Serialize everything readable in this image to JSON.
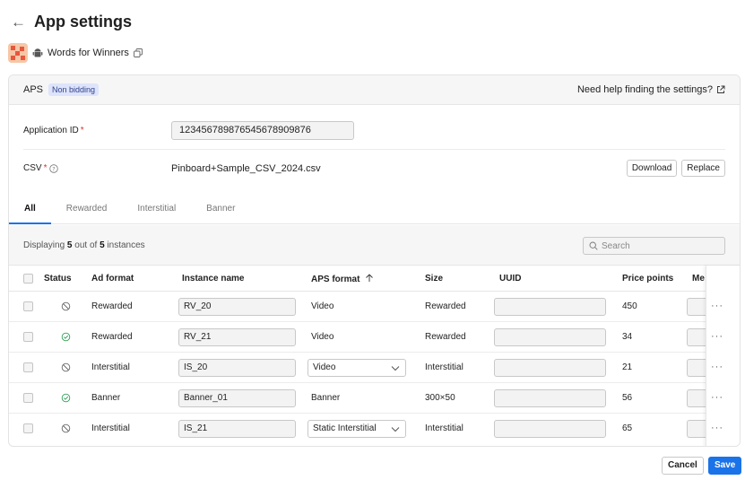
{
  "page": {
    "title": "App settings",
    "app_name": "Words for Winners"
  },
  "aps": {
    "label": "APS",
    "badge": "Non bidding",
    "help_link": "Need help finding the settings?"
  },
  "form": {
    "app_id_label": "Application ID",
    "app_id_value": "12345678987654567890987​6",
    "csv_label": "CSV",
    "csv_file": "Pinboard+Sample_CSV_2024.csv",
    "download_label": "Download",
    "replace_label": "Replace",
    "required_mark": "*"
  },
  "tabs": [
    "All",
    "Rewarded",
    "Interstitial",
    "Banner"
  ],
  "listing": {
    "prefix": "Displaying",
    "shown": "5",
    "middle": "out of",
    "total": "5",
    "suffix": "instances",
    "search_placeholder": "Search"
  },
  "table": {
    "headers": {
      "status": "Status",
      "ad_format": "Ad format",
      "instance_name": "Instance name",
      "aps_format": "APS format",
      "size": "Size",
      "uuid": "UUID",
      "price_points": "Price points",
      "me": "Me"
    },
    "rows": [
      {
        "status": "inactive",
        "ad_format": "Rewarded",
        "instance_name": "RV_20",
        "aps_format": "Video",
        "aps_is_select": false,
        "size": "Rewarded",
        "price_points": "450"
      },
      {
        "status": "active",
        "ad_format": "Rewarded",
        "instance_name": "RV_21",
        "aps_format": "Video",
        "aps_is_select": false,
        "size": "Rewarded",
        "price_points": "34"
      },
      {
        "status": "inactive",
        "ad_format": "Interstitial",
        "instance_name": "IS_20",
        "aps_format": "Video",
        "aps_is_select": true,
        "size": "Interstitial",
        "price_points": "21"
      },
      {
        "status": "active",
        "ad_format": "Banner",
        "instance_name": "Banner_01",
        "aps_format": "Banner",
        "aps_is_select": false,
        "size": "300×50",
        "price_points": "56"
      },
      {
        "status": "inactive",
        "ad_format": "Interstitial",
        "instance_name": "IS_21",
        "aps_format": "Static Interstitial",
        "aps_is_select": true,
        "size": "Interstitial",
        "price_points": "65"
      }
    ],
    "more_label": "···"
  },
  "footer": {
    "cancel_label": "Cancel",
    "save_label": "Save"
  },
  "colors": {
    "accent": "#1a73e8",
    "active_status": "#2e9e52",
    "inactive_status": "#666666",
    "badge_bg": "#dde4fb"
  }
}
